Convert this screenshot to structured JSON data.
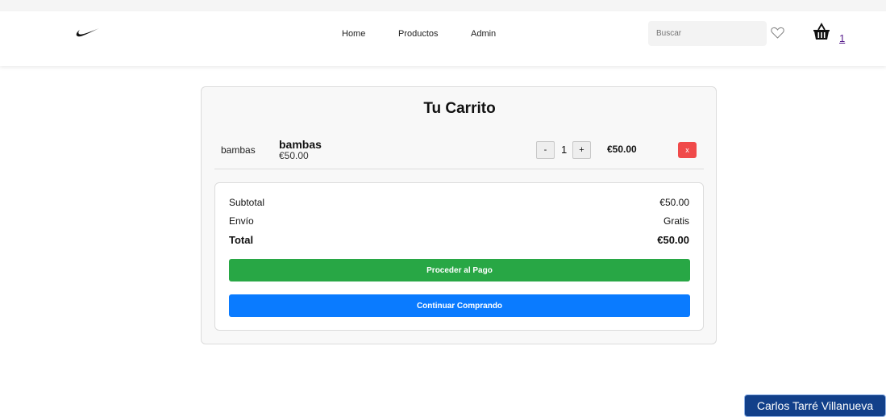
{
  "nav": {
    "links": [
      "Home",
      "Productos",
      "Admin"
    ],
    "search_placeholder": "Buscar",
    "cart_count": "1"
  },
  "cart": {
    "title": "Tu Carrito",
    "item": {
      "image_alt": "bambas",
      "name": "bambas",
      "unit_price": "€50.00",
      "minus": "-",
      "quantity": "1",
      "plus": "+",
      "total": "€50.00",
      "remove": "x"
    },
    "summary": {
      "subtotal_label": "Subtotal",
      "subtotal_value": "€50.00",
      "shipping_label": "Envío",
      "shipping_value": "Gratis",
      "total_label": "Total",
      "total_value": "€50.00",
      "checkout_label": "Proceder al Pago",
      "continue_label": "Continuar Comprando"
    }
  },
  "footer": {
    "author": "Carlos Tarré Villanueva"
  },
  "colors": {
    "checkout": "#28a745",
    "continue": "#0a7bff",
    "remove": "#f04a4a",
    "badge": "#12408a"
  }
}
